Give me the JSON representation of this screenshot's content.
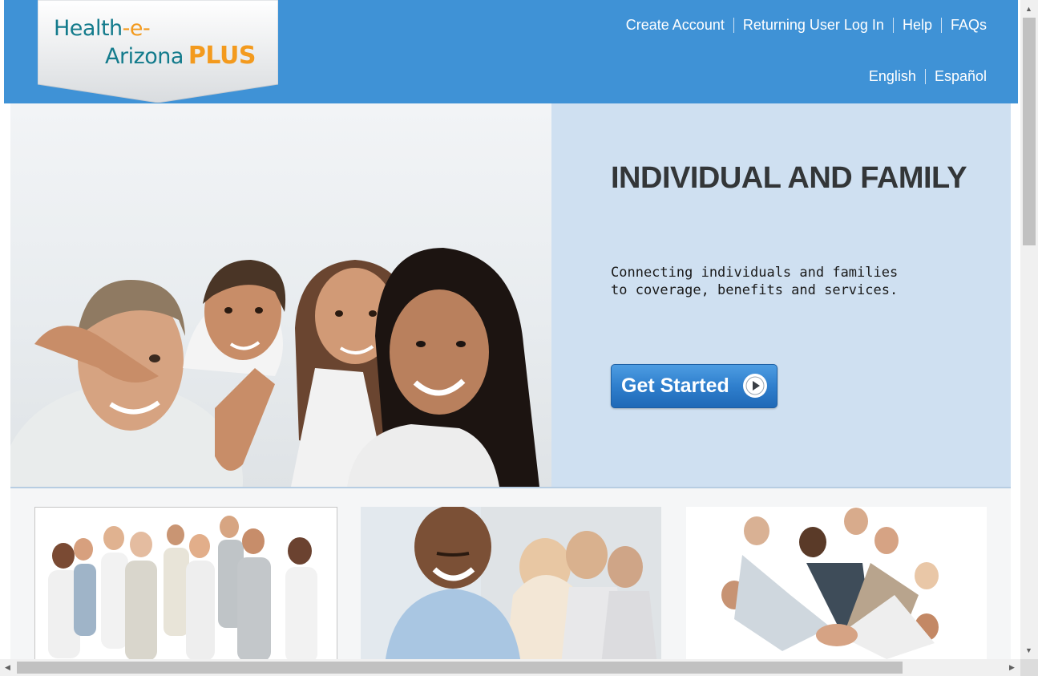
{
  "header": {
    "logo": {
      "line1_main": "Health",
      "line1_accent": "-e-",
      "line2_main": "Arizona",
      "line2_accent": "PLUS"
    },
    "nav_links": [
      "Create Account",
      "Returning User Log In",
      "Help",
      "FAQs"
    ],
    "language_links": [
      "English",
      "Español"
    ]
  },
  "hero": {
    "title": "INDIVIDUAL AND FAMILY",
    "subtitle": "Connecting individuals and families to coverage, benefits and services.",
    "button_label": "Get Started",
    "image_icon": "family-photo"
  },
  "cards": [
    {
      "image_icon": "group-of-people-photo"
    },
    {
      "image_icon": "smiling-man-photo"
    },
    {
      "image_icon": "team-hands-together-photo"
    }
  ],
  "colors": {
    "header_bg": "#3f92d6",
    "hero_panel_bg": "#cfe0f1",
    "button_blue": "#2f7fcd",
    "logo_teal": "#137b8c",
    "logo_orange": "#f39a1e"
  }
}
